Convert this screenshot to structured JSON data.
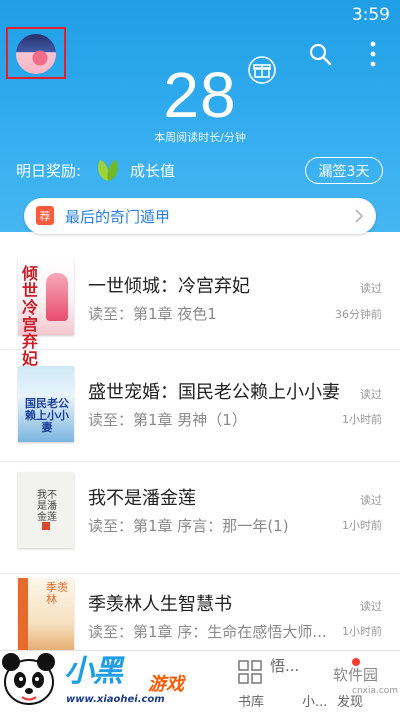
{
  "status_bar": {
    "time": "3:59"
  },
  "header": {
    "reading_minutes": "28",
    "reading_caption": "本周阅读时长/分钟",
    "reward_label": "明日奖励:",
    "reward_value": "成长值",
    "missed_signin_label": "漏签3天",
    "colors": {
      "header_blue": "#1f9ee6",
      "avatar_frame": "#e0202a"
    },
    "icons": [
      "search-icon",
      "more-vertical-icon",
      "gift-icon",
      "leaf-icon"
    ]
  },
  "recommendation": {
    "badge": "荐",
    "title": "最后的奇门遁甲"
  },
  "books": [
    {
      "title": "一世倾城：冷宫弃妃",
      "progress": "读至：第1章 夜色1",
      "read_label": "读过",
      "time": "36分钟前",
      "cover_text": "倾世冷宫弃妃"
    },
    {
      "title": "盛世宠婚：国民老公赖上小小妻",
      "progress": "读至：第1章 男神（1）",
      "read_label": "读过",
      "time": "1小时前",
      "cover_text": "国民老公赖上小小妻"
    },
    {
      "title": "我不是潘金莲",
      "progress": "读至：第1章 序言：那一年(1)",
      "read_label": "读过",
      "time": "1小时前",
      "cover_text": "我不是潘金莲"
    },
    {
      "title": "季羡林人生智慧书",
      "progress": "读至：第1章 序：生命在感悟大师...",
      "read_label": "读过",
      "time": "1小时前",
      "cover_text": "季羡林"
    }
  ],
  "bottom_nav": {
    "items": [
      {
        "label": "书库"
      },
      {
        "label": "悟..."
      },
      {
        "label": "小..."
      },
      {
        "label": "发现"
      }
    ]
  },
  "watermark": {
    "title": "小黑",
    "subtitle": "游戏",
    "url": "www.xiaohei.com",
    "right_text": "软件园",
    "right_url": "cnxia.com"
  }
}
